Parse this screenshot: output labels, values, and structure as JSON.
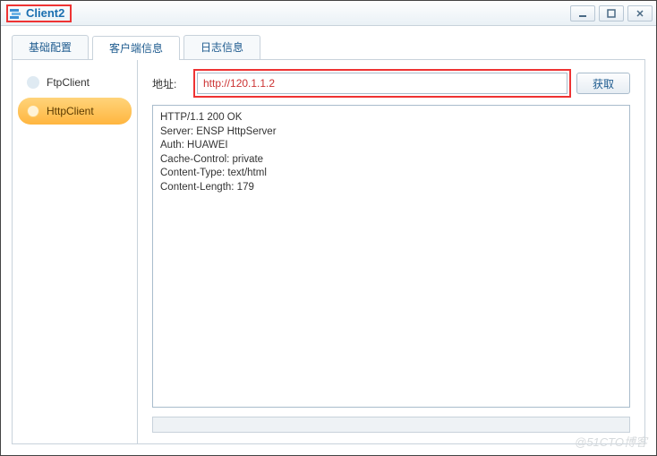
{
  "window": {
    "title": "Client2"
  },
  "tabs": {
    "basic": "基础配置",
    "client_info": "客户端信息",
    "log_info": "日志信息"
  },
  "sidebar": {
    "items": [
      {
        "label": "FtpClient"
      },
      {
        "label": "HttpClient"
      }
    ]
  },
  "main": {
    "address_label": "地址:",
    "address_value": "http://120.1.1.2",
    "fetch_label": "获取",
    "response": "HTTP/1.1 200 OK\nServer: ENSP HttpServer\nAuth: HUAWEI\nCache-Control: private\nContent-Type: text/html\nContent-Length: 179"
  },
  "watermark": "@51CTO博客"
}
